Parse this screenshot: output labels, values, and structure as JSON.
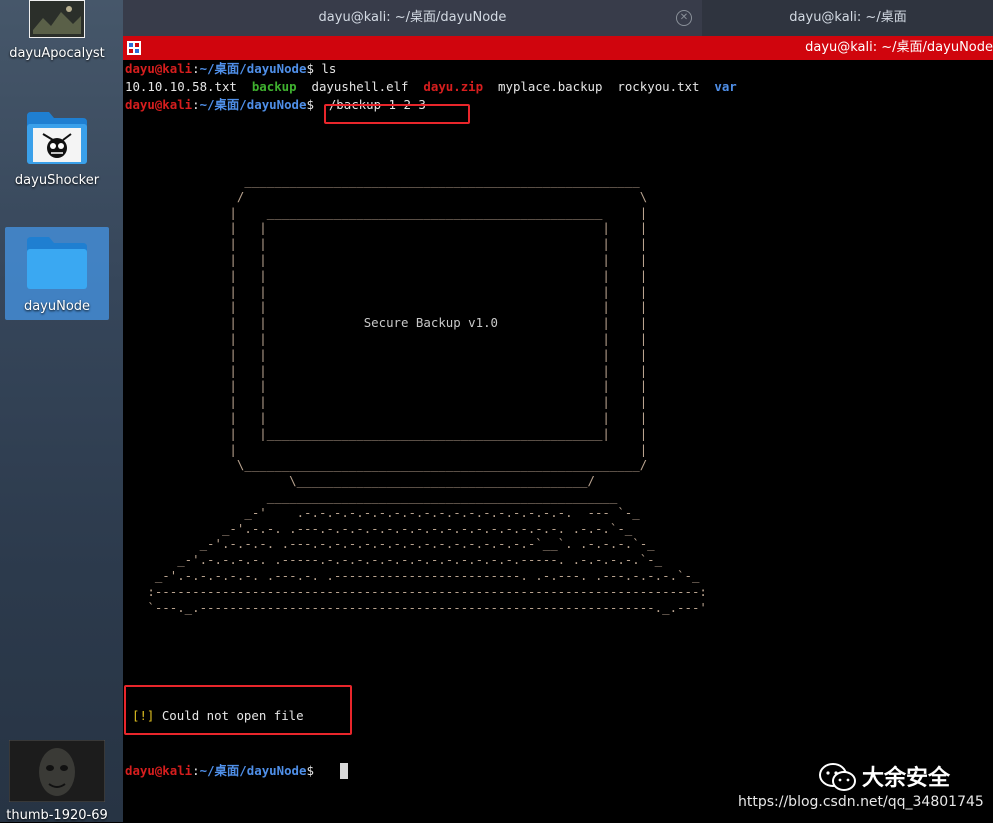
{
  "desktop": {
    "icons": [
      {
        "label": "dayuApocalyst",
        "type": "image"
      },
      {
        "label": "dayuShocker",
        "type": "folder"
      },
      {
        "label": "dayuNode",
        "type": "folder",
        "selected": true
      },
      {
        "label": "thumb-1920-69",
        "type": "image"
      }
    ]
  },
  "tabs": [
    {
      "label": "dayu@kali: ~/桌面/dayuNode",
      "active": true
    },
    {
      "label": "dayu@kali: ~/桌面",
      "active": false
    }
  ],
  "window": {
    "title": "dayu@kali: ~/桌面/dayuNode",
    "accent_color": "#d0050d"
  },
  "terminal": {
    "prompt_user": "dayu@kali",
    "prompt_path": "~/桌面/dayuNode",
    "prompt_sep": ":",
    "prompt_symbol": "$",
    "cmd1": " ls",
    "files": [
      {
        "name": "10.10.10.58.txt",
        "color": "white"
      },
      {
        "name": "backup",
        "color": "green"
      },
      {
        "name": "dayushell.elf",
        "color": "white"
      },
      {
        "name": "dayu.zip",
        "color": "red"
      },
      {
        "name": "myplace.backup",
        "color": "white"
      },
      {
        "name": "rockyou.txt",
        "color": "white"
      },
      {
        "name": "var",
        "color": "blue"
      }
    ],
    "cmd2": " ./backup 1 2 3",
    "banner_title": "Secure Backup v1.0",
    "error_tag": "[!]",
    "error_message": " Could not open file"
  },
  "watermark": {
    "title": "大余安全",
    "url": "https://blog.csdn.net/qq_34801745"
  }
}
